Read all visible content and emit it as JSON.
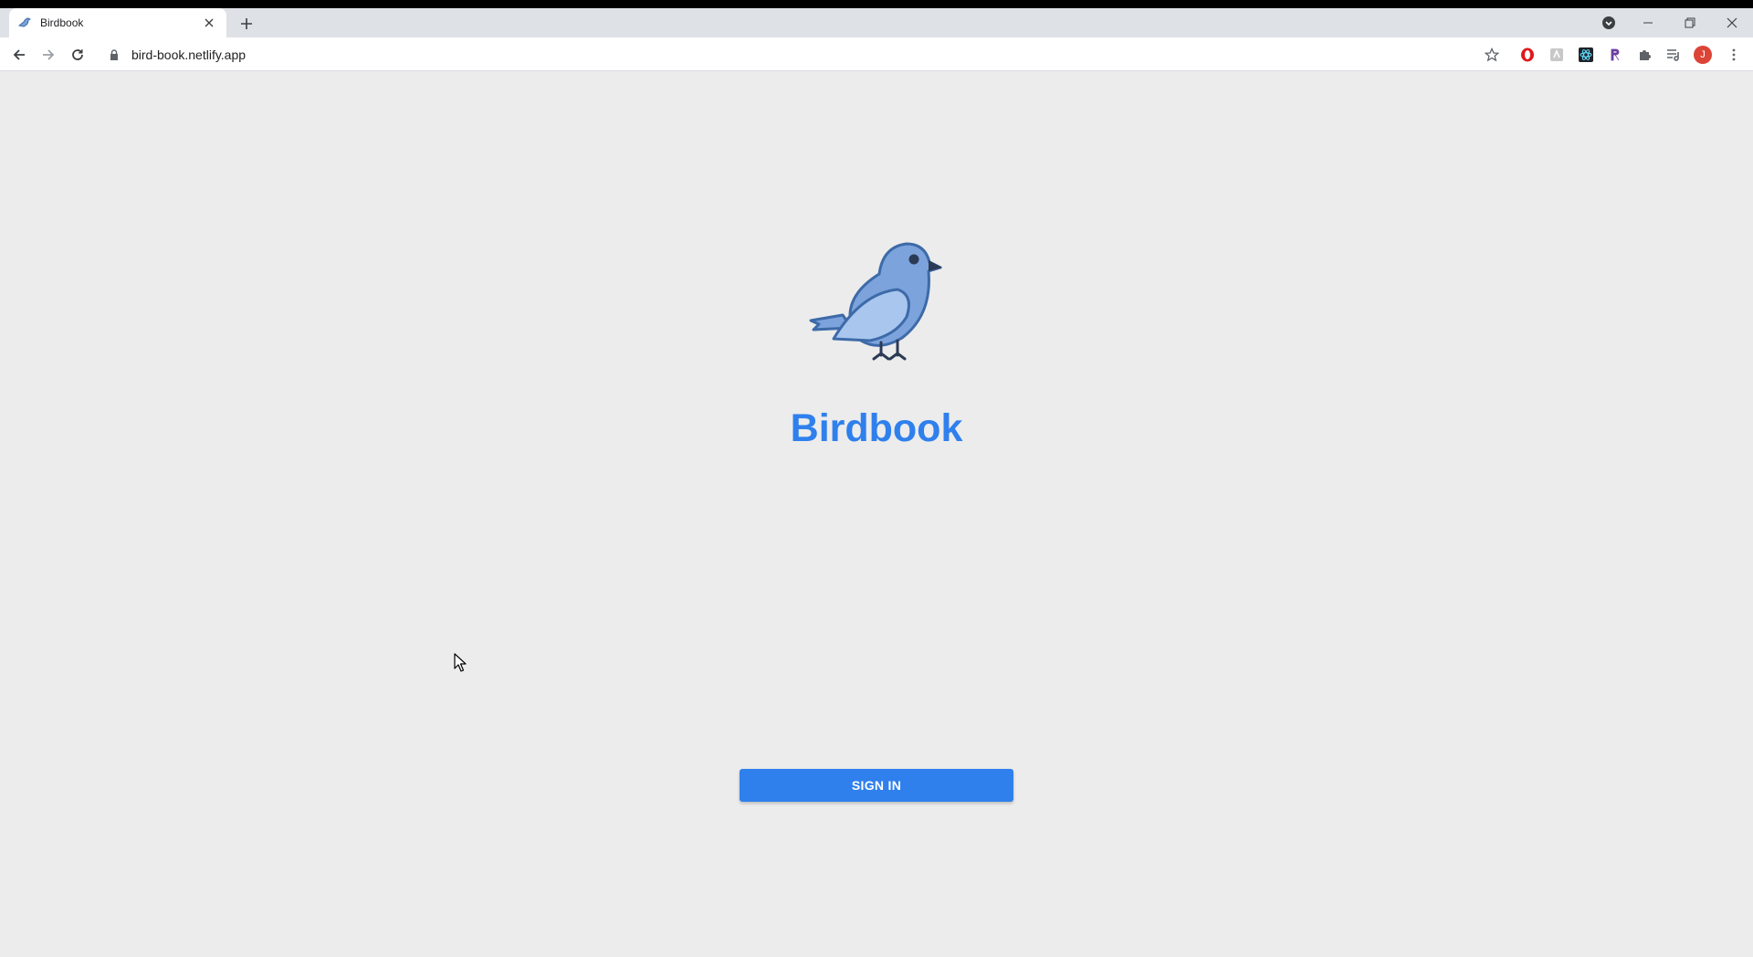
{
  "browser": {
    "tab": {
      "title": "Birdbook",
      "favicon": "bird-favicon-icon"
    },
    "address_bar": {
      "url": "bird-book.netlify.app"
    },
    "profile_initial": "J",
    "extension_icons": [
      "opera-icon",
      "extension-generic-icon",
      "react-devtools-icon",
      "r-extension-icon",
      "puzzle-icon",
      "media-queue-icon"
    ]
  },
  "page": {
    "brand_title": "Birdbook",
    "signin_label": "SIGN IN"
  },
  "colors": {
    "brand_blue": "#2f80ed",
    "bird_fill": "#7ca3dc",
    "bird_stroke": "#3d6aa8",
    "page_bg": "#ececec"
  }
}
